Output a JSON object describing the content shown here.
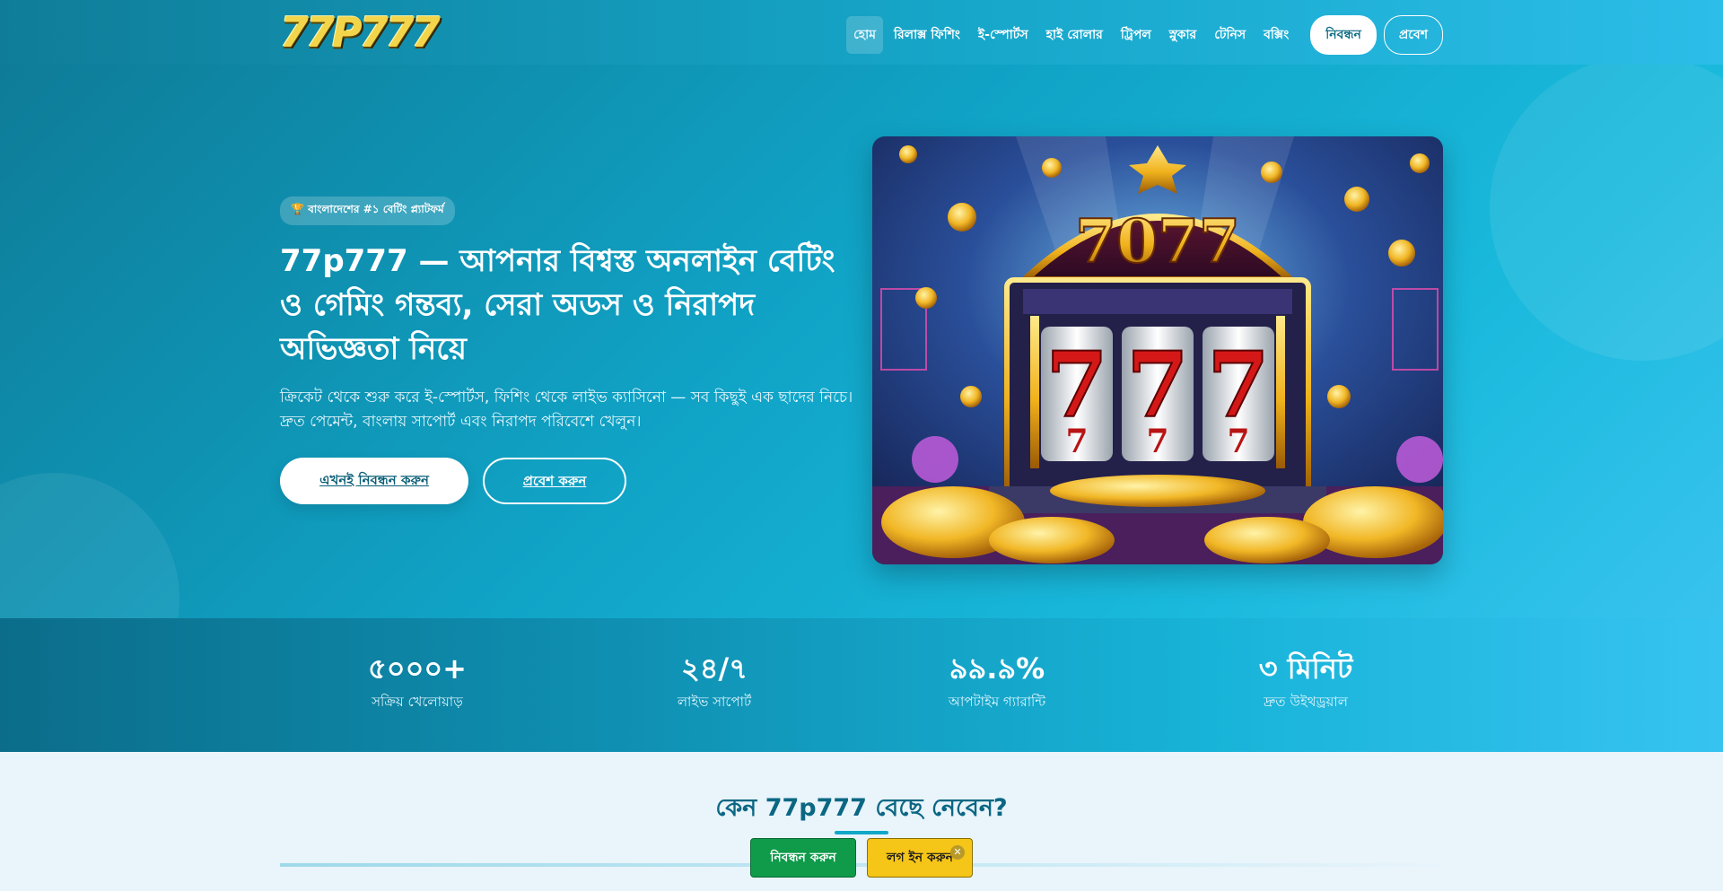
{
  "header": {
    "logo_text": "77P777",
    "nav": [
      {
        "label": "হোম"
      },
      {
        "label": "রিলাক্স ফিশিং"
      },
      {
        "label": "ই-স্পোর্টস"
      },
      {
        "label": "হাই রোলার"
      },
      {
        "label": "ট্রিপল"
      },
      {
        "label": "স্নুকার"
      },
      {
        "label": "টেনিস"
      },
      {
        "label": "বক্সিং"
      }
    ],
    "register_label": "নিবন্ধন",
    "login_label": "প্রবেশ"
  },
  "hero": {
    "badge": "🏆 বাংলাদেশের #১ বেটিং প্ল্যাটফর্ম",
    "title": "77p777 — আপনার বিশ্বস্ত অনলাইন বেটিং ও গেমিং গন্তব্য, সেরা অডস ও নিরাপদ অভিজ্ঞতা নিয়ে",
    "description": "ক্রিকেট থেকে শুরু করে ই-স্পোর্টস, ফিশিং থেকে লাইভ ক্যাসিনো — সব কিছুই এক ছাদের নিচে। দ্রুত পেমেন্ট, বাংলায় সাপোর্ট এবং নিরাপদ পরিবেশে খেলুন।",
    "register_button": "এখনই নিবন্ধন করুন",
    "login_button": "প্রবেশ করুন",
    "image_text": "7077"
  },
  "stats": [
    {
      "value": "৫০০০+",
      "label": "সক্রিয় খেলোয়াড়"
    },
    {
      "value": "২৪/৭",
      "label": "লাইভ সাপোর্ট"
    },
    {
      "value": "৯৯.৯%",
      "label": "আপটাইম গ্যারান্টি"
    },
    {
      "value": "৩ মিনিট",
      "label": "দ্রুত উইথড্রয়াল"
    }
  ],
  "why": {
    "title": "কেন 77p777 বেছে নেবেন?"
  },
  "floating": {
    "register_label": "নিবন্ধন করুন",
    "login_label": "লগ ইন করুন",
    "close_glyph": "✕"
  },
  "colors": {
    "accent": "#10a8c8",
    "gold": "#f5c518",
    "green": "#0f9b4a"
  }
}
